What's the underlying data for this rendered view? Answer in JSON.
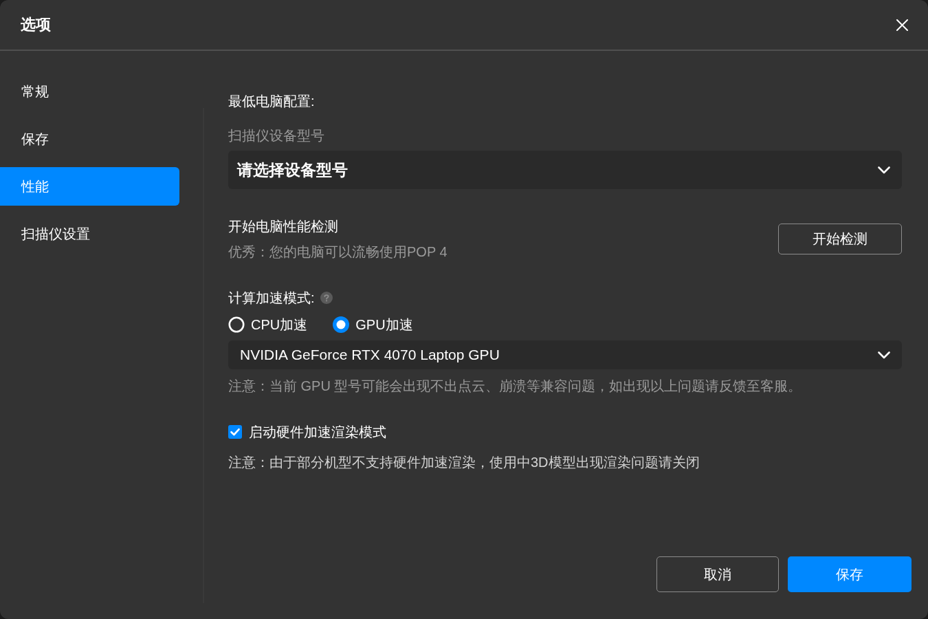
{
  "window": {
    "title": "选项"
  },
  "sidebar": {
    "items": [
      {
        "label": "常规",
        "selected": false
      },
      {
        "label": "保存",
        "selected": false
      },
      {
        "label": "性能",
        "selected": true
      },
      {
        "label": "扫描仪设置",
        "selected": false
      }
    ]
  },
  "performance": {
    "minimum_config": {
      "heading": "最低电脑配置:",
      "label": "扫描仪设备型号",
      "dropdown": {
        "placeholder": "请选择设备型号"
      }
    },
    "check": {
      "title": "开始电脑性能检测",
      "result": "优秀：您的电脑可以流畅使用POP 4",
      "button": "开始检测"
    },
    "acceleration": {
      "label": "计算加速模式:",
      "options": [
        {
          "label": "CPU加速",
          "selected": false
        },
        {
          "label": "GPU加速",
          "selected": true
        }
      ],
      "device": {
        "value": "NVIDIA GeForce RTX 4070 Laptop GPU"
      },
      "note": "注意：当前 GPU 型号可能会出现不出点云、崩溃等兼容问题，如出现以上问题请反馈至客服。"
    },
    "hardware_rendering": {
      "label": "启动硬件加速渲染模式",
      "checked": true,
      "note": "注意：由于部分机型不支持硬件加速渲染，使用中3D模型出现渲染问题请关闭"
    }
  },
  "buttons": [
    {
      "label": "取消",
      "kind": "secondary"
    },
    {
      "label": "保存",
      "kind": "primary"
    }
  ]
}
